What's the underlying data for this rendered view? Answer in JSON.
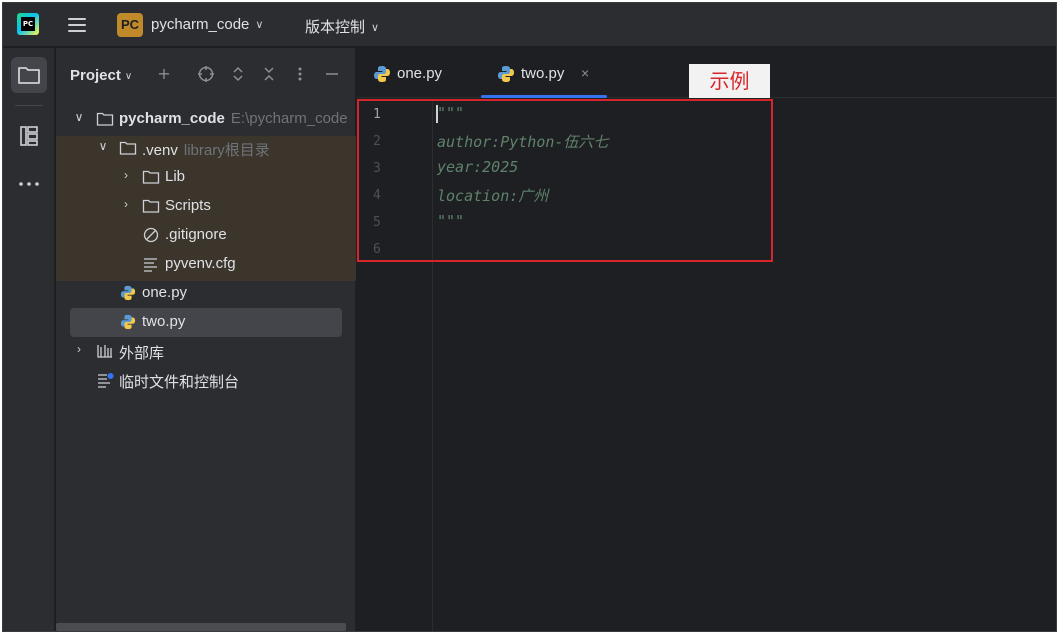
{
  "titlebar": {
    "project_badge": "PC",
    "project_name": "pycharm_code",
    "vcs_label": "版本控制"
  },
  "project_panel": {
    "title": "Project",
    "tree": [
      {
        "label": "pycharm_code",
        "hint": "E:\\pycharm_code",
        "type": "folder",
        "expanded": true,
        "bold": true
      },
      {
        "label": ".venv",
        "hint": "library根目录",
        "type": "folder",
        "expanded": true
      },
      {
        "label": "Lib",
        "type": "folder",
        "expanded": false
      },
      {
        "label": "Scripts",
        "type": "folder",
        "expanded": false
      },
      {
        "label": ".gitignore",
        "type": "ignore-file"
      },
      {
        "label": "pyvenv.cfg",
        "type": "config-file"
      },
      {
        "label": "one.py",
        "type": "python-file"
      },
      {
        "label": "two.py",
        "type": "python-file",
        "selected": true
      },
      {
        "label": "外部库",
        "type": "library",
        "expanded": false
      },
      {
        "label": "临时文件和控制台",
        "type": "scratches"
      }
    ]
  },
  "editor": {
    "tabs": [
      {
        "label": "one.py",
        "active": false
      },
      {
        "label": "two.py",
        "active": true,
        "close": "×"
      }
    ],
    "line_numbers": [
      "1",
      "2",
      "3",
      "4",
      "5",
      "6"
    ],
    "lines": [
      "\"\"\"",
      "author:Python-伍六七",
      "year:2025",
      "location:广州",
      "\"\"\"",
      ""
    ]
  },
  "annotation": {
    "label": "示例",
    "color": "#d7262b"
  },
  "colors": {
    "accent": "#3574f0",
    "docstring": "#5f826b",
    "venv_highlight": "#3b352c"
  }
}
